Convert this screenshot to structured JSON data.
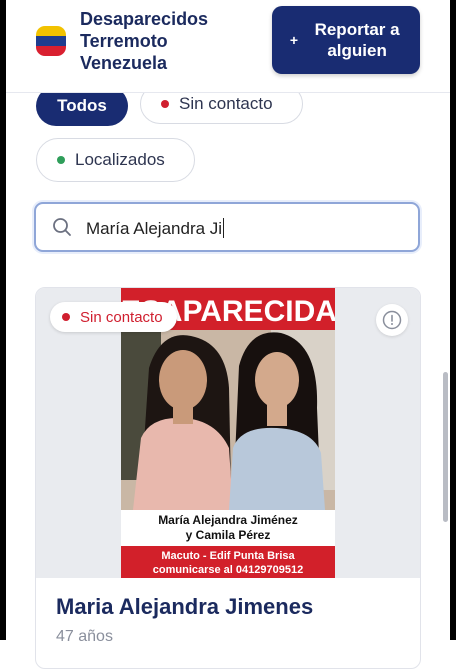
{
  "header": {
    "title_lines": [
      "Desaparecidos",
      "Terremoto",
      "Venezuela"
    ],
    "report_button": {
      "icon": "plus-icon",
      "plus": "+",
      "label": "Reportar a alguien"
    },
    "flag_colors": [
      "#f2c200",
      "#1f3d8f",
      "#d92030"
    ]
  },
  "filters": [
    {
      "label": "Todos",
      "active": true
    },
    {
      "label": "Sin contacto",
      "dot_color": "#d01f2f"
    },
    {
      "label": "Localizados",
      "dot_color": "#2f9e5a"
    }
  ],
  "search": {
    "icon": "search-icon",
    "value": "María Alejandra Ji"
  },
  "card": {
    "status": {
      "label": "Sin contacto",
      "color": "#d01f2f"
    },
    "info_icon": "info-circle-icon",
    "poster": {
      "banner": "DESAPARECIDAS",
      "names_line1": "María Alejandra Jiménez",
      "names_line2": "y Camila Pérez",
      "location": "Macuto - Edif Punta Brisa",
      "contact": "comunicarse al 04129709512"
    },
    "name": "Maria Alejandra Jimenes",
    "age": "47 años"
  },
  "colors": {
    "primary": "#192c72",
    "danger": "#d01f2f",
    "success": "#2f9e5a"
  }
}
